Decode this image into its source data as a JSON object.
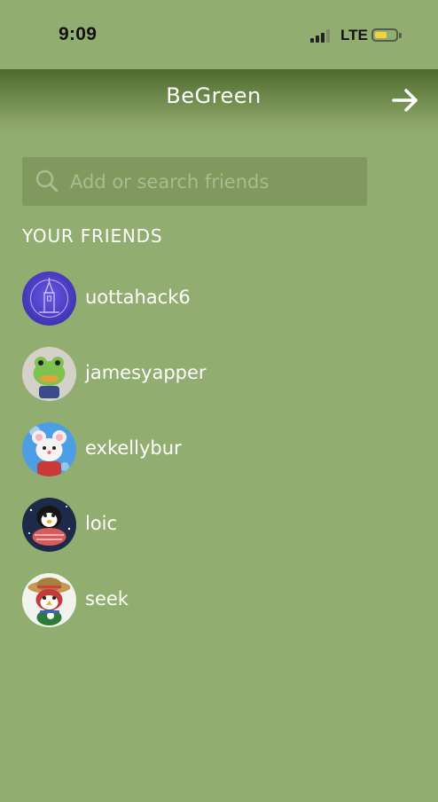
{
  "status_bar": {
    "time": "9:09",
    "network": "LTE",
    "battery_level": 0.6,
    "battery_color": "#f3d03e"
  },
  "header": {
    "title": "BeGreen",
    "next_icon": "arrow-right-icon"
  },
  "search": {
    "placeholder": "Add or search friends",
    "value": "",
    "icon": "search-icon"
  },
  "friends_section": {
    "title": "YOUR FRIENDS",
    "friends": [
      {
        "name": "uottahack6",
        "avatar": "tower-logo-avatar"
      },
      {
        "name": "jamesyapper",
        "avatar": "frog-villager-avatar"
      },
      {
        "name": "exkellybur",
        "avatar": "mouse-villager-avatar"
      },
      {
        "name": "loic",
        "avatar": "penguin-villager-avatar"
      },
      {
        "name": "seek",
        "avatar": "bird-villager-avatar"
      }
    ]
  },
  "colors": {
    "background": "#92ad70",
    "header_dark": "#4f6a2e",
    "search_bg": "#7f995e"
  }
}
